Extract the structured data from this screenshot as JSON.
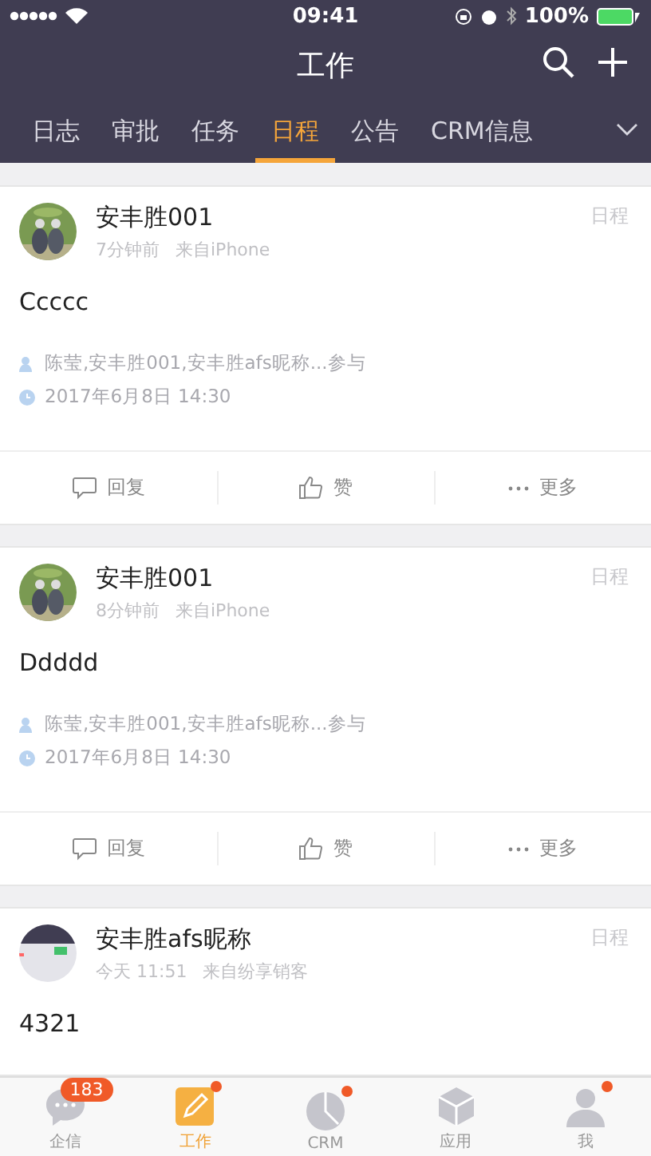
{
  "status_bar": {
    "time": "09:41",
    "battery": "100%"
  },
  "header": {
    "title": "工作"
  },
  "tabs": [
    {
      "label": "日志",
      "selected": false
    },
    {
      "label": "审批",
      "selected": false
    },
    {
      "label": "任务",
      "selected": false
    },
    {
      "label": "日程",
      "selected": true
    },
    {
      "label": "公告",
      "selected": false
    },
    {
      "label": "CRM信息",
      "selected": false
    }
  ],
  "posts": [
    {
      "author": "安丰胜001",
      "time": "7分钟前",
      "source": "来自iPhone",
      "type": "日程",
      "content": "Ccccc",
      "participants": "陈莹,安丰胜001,安丰胜afs昵称...参与",
      "date": "2017年6月8日 14:30",
      "actions": [
        "回复",
        "赞",
        "更多"
      ]
    },
    {
      "author": "安丰胜001",
      "time": "8分钟前",
      "source": "来自iPhone",
      "type": "日程",
      "content": "Ddddd",
      "participants": "陈莹,安丰胜001,安丰胜afs昵称...参与",
      "date": "2017年6月8日 14:30",
      "actions": [
        "回复",
        "赞",
        "更多"
      ]
    },
    {
      "author": "安丰胜afs昵称",
      "time": "今天 11:51",
      "source": "来自纷享销客",
      "type": "日程",
      "content": "4321"
    }
  ],
  "bottom_tabs": [
    {
      "kind": "chat",
      "label": "企信",
      "selected": false,
      "badge": "183",
      "dot": false
    },
    {
      "kind": "work",
      "label": "工作",
      "selected": true,
      "dot": true
    },
    {
      "kind": "crm",
      "label": "CRM",
      "selected": false,
      "dot": true
    },
    {
      "kind": "apps",
      "label": "应用",
      "selected": false,
      "dot": false
    },
    {
      "kind": "me",
      "label": "我",
      "selected": false,
      "dot": true
    }
  ]
}
